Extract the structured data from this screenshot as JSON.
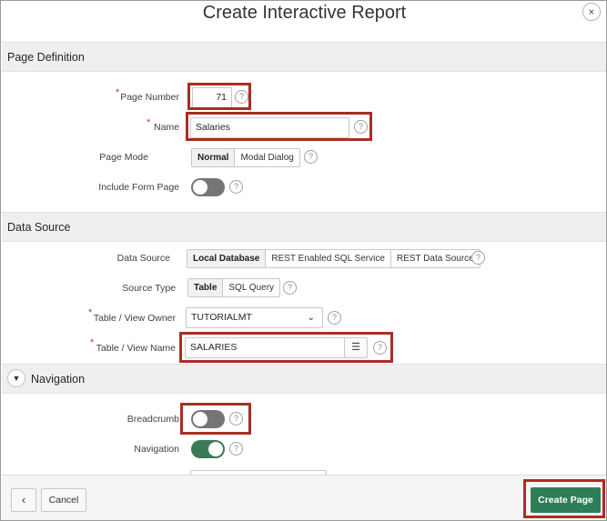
{
  "dialog": {
    "title": "Create Interactive Report",
    "close_glyph": "×"
  },
  "icons": {
    "help": "?",
    "close": "close-icon",
    "chevron": "chevron-down-icon",
    "list": "list-icon",
    "collapse": "caret-down-icon"
  },
  "colors": {
    "highlight": "#a92d23",
    "primary": "#2e7d57",
    "toggle_on": "#3b7a57",
    "toggle_off": "#757575",
    "required": "#c0392b"
  },
  "page_definition": {
    "heading": "Page Definition",
    "page_number": {
      "label": "Page Number",
      "value": "71",
      "required": "*"
    },
    "name": {
      "label": "Name",
      "value": "Salaries",
      "required": "*"
    },
    "page_mode": {
      "label": "Page Mode",
      "options": [
        "Normal",
        "Modal Dialog"
      ],
      "selected": "Normal"
    },
    "include_form_page": {
      "label": "Include Form Page",
      "state": "off"
    }
  },
  "data_source": {
    "heading": "Data Source",
    "data_source": {
      "label": "Data Source",
      "options": [
        "Local Database",
        "REST Enabled SQL Service",
        "REST Data Source"
      ],
      "selected": "Local Database"
    },
    "source_type": {
      "label": "Source Type",
      "options": [
        "Table",
        "SQL Query"
      ],
      "selected": "Table"
    },
    "table_owner": {
      "label": "Table / View Owner",
      "value": "TUTORIALMT",
      "required": "*",
      "chevron": "⌄"
    },
    "table_name": {
      "label": "Table / View Name",
      "value": "SALARIES",
      "required": "*",
      "list_glyph": "☰"
    }
  },
  "navigation": {
    "heading": "Navigation",
    "collapse_glyph": "▼",
    "breadcrumb": {
      "label": "Breadcrumb",
      "state": "off"
    },
    "navigation": {
      "label": "Navigation",
      "state": "on"
    }
  },
  "footer": {
    "back_glyph": "‹",
    "cancel_label": "Cancel",
    "create_label": "Create Page"
  }
}
